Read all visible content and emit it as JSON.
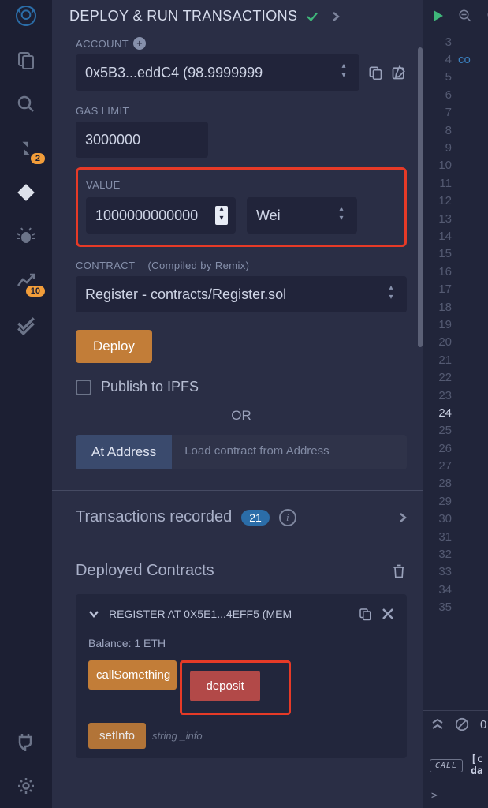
{
  "header": {
    "title": "DEPLOY & RUN TRANSACTIONS"
  },
  "account": {
    "label": "ACCOUNT",
    "value": "0x5B3...eddC4 (98.9999999"
  },
  "gas": {
    "label": "GAS LIMIT",
    "value": "3000000"
  },
  "value": {
    "label": "VALUE",
    "amount": "1000000000000",
    "unit": "Wei"
  },
  "contract": {
    "label": "CONTRACT",
    "hint": "(Compiled by Remix)",
    "selected": "Register - contracts/Register.sol"
  },
  "deploy": {
    "button": "Deploy",
    "publish": "Publish to IPFS",
    "or": "OR",
    "atAddress": "At Address",
    "loadPlaceholder": "Load contract from Address"
  },
  "tx": {
    "title": "Transactions recorded",
    "count": "21"
  },
  "deployed": {
    "title": "Deployed Contracts",
    "instance": "REGISTER AT 0X5E1...4EFF5 (MEM",
    "balance": "Balance: 1 ETH",
    "fn_call": "callSomething",
    "fn_deposit": "deposit",
    "fn_setinfo": "setInfo",
    "fn_setinfo_arg": "string _info"
  },
  "rail": {
    "badge1": "2",
    "badge2": "10"
  },
  "editor": {
    "lines": [
      "3",
      "4",
      "5",
      "6",
      "7",
      "8",
      "9",
      "10",
      "11",
      "12",
      "13",
      "14",
      "15",
      "16",
      "17",
      "18",
      "19",
      "20",
      "21",
      "22",
      "23",
      "24",
      "25",
      "26",
      "27",
      "28",
      "29",
      "30",
      "31",
      "32",
      "33",
      "34",
      "35"
    ],
    "highlight": "24",
    "token4": "co"
  },
  "console": {
    "count": "0",
    "call": "CALL",
    "text1": "[c",
    "text2": "da",
    "prompt": ">"
  }
}
